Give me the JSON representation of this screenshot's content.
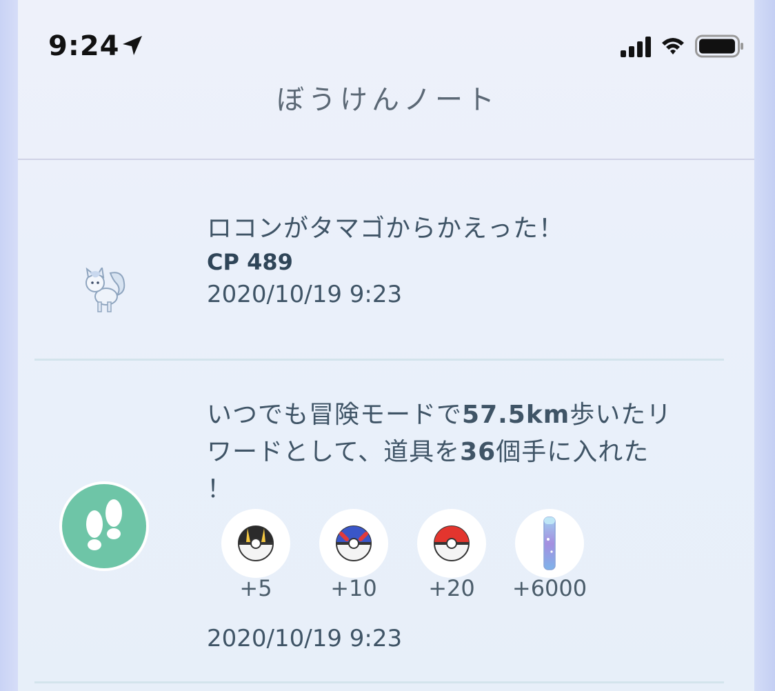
{
  "status_bar": {
    "time": "9:24",
    "icons": [
      "location-arrow-icon",
      "cellular-signal-icon",
      "wifi-icon",
      "battery-icon"
    ]
  },
  "header": {
    "title": "ぼうけんノート"
  },
  "entries": [
    {
      "icon": "vulpix-sprite",
      "headline": "ロコンがタマゴからかえった！",
      "cp": "CP 489",
      "date": "2020/10/19 9:23"
    },
    {
      "icon": "footprints-icon",
      "headline_parts": [
        "いつでも冒険モードで",
        "57.5km",
        "歩いたリ",
        "ワードとして、道具を",
        "36",
        "個手に入れた",
        "！"
      ],
      "items": [
        {
          "icon": "ultra-ball-icon",
          "count": "+5"
        },
        {
          "icon": "great-ball-icon",
          "count": "+10"
        },
        {
          "icon": "poke-ball-icon",
          "count": "+20"
        },
        {
          "icon": "stardust-icon",
          "count": "+6000"
        }
      ],
      "date": "2020/10/19 9:23"
    }
  ],
  "colors": {
    "panel_bg": "#eaf0fa",
    "text": "#3f5466",
    "footprint_badge": "#6ec5a7",
    "divider": "#d3e4ec"
  }
}
